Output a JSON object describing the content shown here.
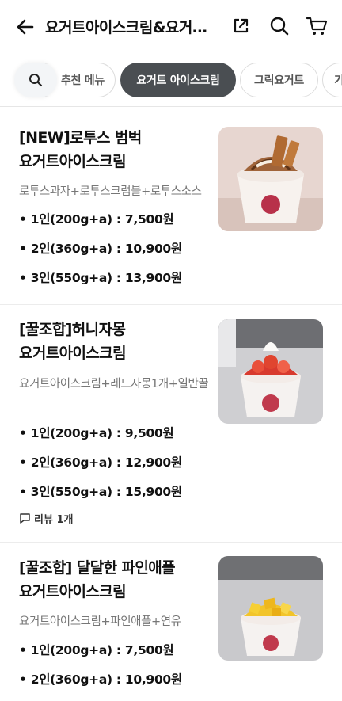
{
  "header": {
    "title": "요거트아이스크림&요거트 외 간식",
    "icons": [
      "back-arrow-icon",
      "share-icon",
      "search-icon",
      "cart-icon"
    ]
  },
  "tabs": [
    {
      "label": "추천 메뉴",
      "active": false
    },
    {
      "label": "요거트 아이스크림",
      "active": true
    },
    {
      "label": "그릭요거트",
      "active": false
    },
    {
      "label": "기타",
      "active": false
    }
  ],
  "menu": [
    {
      "name_line1": "[NEW]로투스 범벅",
      "name_line2": "요거트아이스크림",
      "desc": "로투스과자+로투스크럼블+로투스소스",
      "prices": [
        "• 1인(200g+a) : 7,500원",
        "• 2인(360g+a) : 10,900원",
        "• 3인(550g+a) : 13,900원"
      ],
      "review": ""
    },
    {
      "name_line1": "[꿀조합]허니자몽",
      "name_line2": "요거트아이스크림",
      "desc": "요거트아이스크림+레드자몽1개+일반꿀",
      "prices": [
        "• 1인(200g+a) : 9,500원",
        "• 2인(360g+a) : 12,900원",
        "• 3인(550g+a) : 15,900원"
      ],
      "review": "리뷰 1개"
    },
    {
      "name_line1": "[꿀조합] 달달한 파인애플",
      "name_line2": "요거트아이스크림",
      "desc": "요거트아이스크림+파인애플+연유",
      "prices": [
        "• 1인(200g+a) : 7,500원",
        "• 2인(360g+a) : 10,900원"
      ],
      "review": ""
    }
  ]
}
